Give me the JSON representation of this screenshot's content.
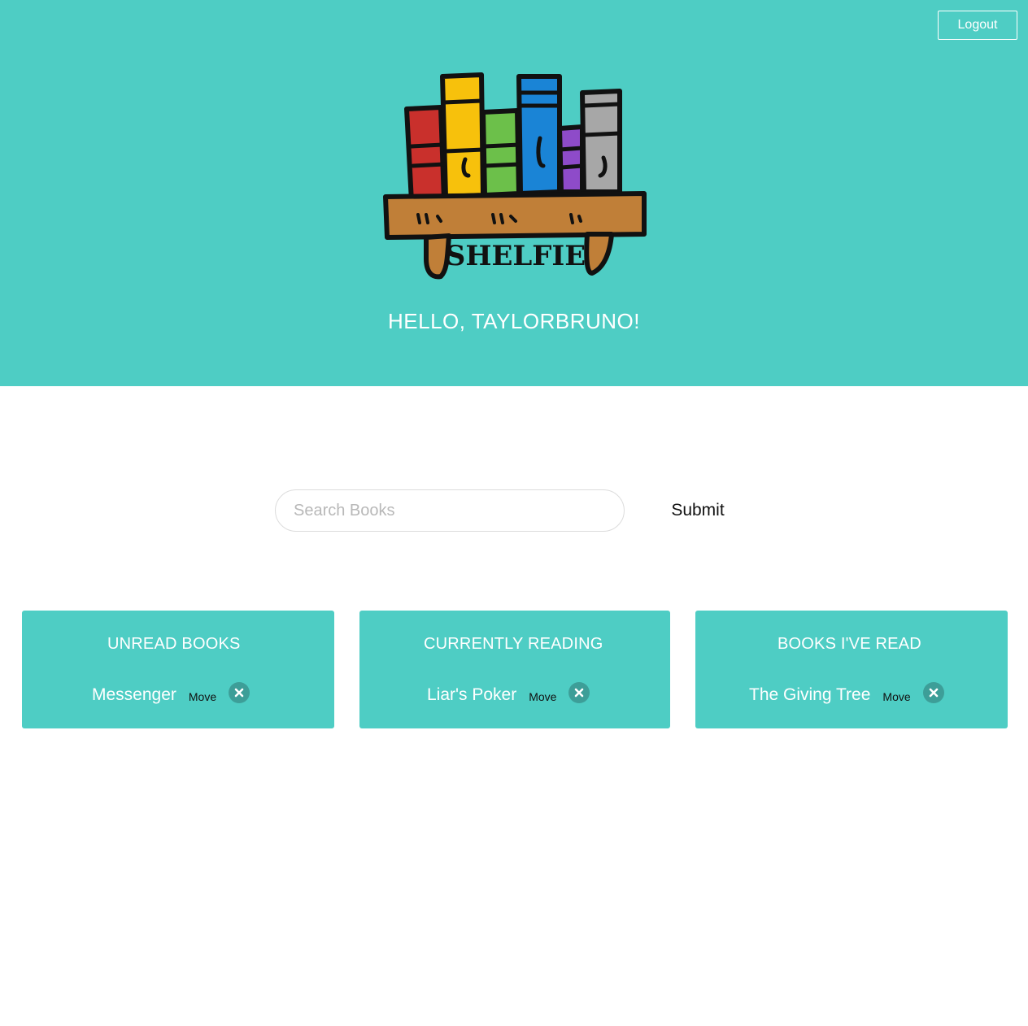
{
  "header": {
    "logout_label": "Logout",
    "greeting": "HELLO, TAYLORBRUNO!",
    "logo_text": "SHELFIE"
  },
  "search": {
    "placeholder": "Search Books",
    "value": "",
    "submit_label": "Submit"
  },
  "shelves": [
    {
      "title": "UNREAD BOOKS",
      "books": [
        {
          "title": "Messenger",
          "move_label": "Move"
        }
      ]
    },
    {
      "title": "CURRENTLY READING",
      "books": [
        {
          "title": "Liar's Poker",
          "move_label": "Move"
        }
      ]
    },
    {
      "title": "BOOKS I'VE READ",
      "books": [
        {
          "title": "The Giving Tree",
          "move_label": "Move"
        }
      ]
    }
  ],
  "colors": {
    "header_bg": "#4ecdc4",
    "card_bg": "#4ecdc4",
    "remove_button_bg": "#3d9e98",
    "text_light": "#ffffff",
    "text_dark": "#111111"
  },
  "icons": {
    "logo": "bookshelf-logo",
    "remove": "close-icon"
  }
}
